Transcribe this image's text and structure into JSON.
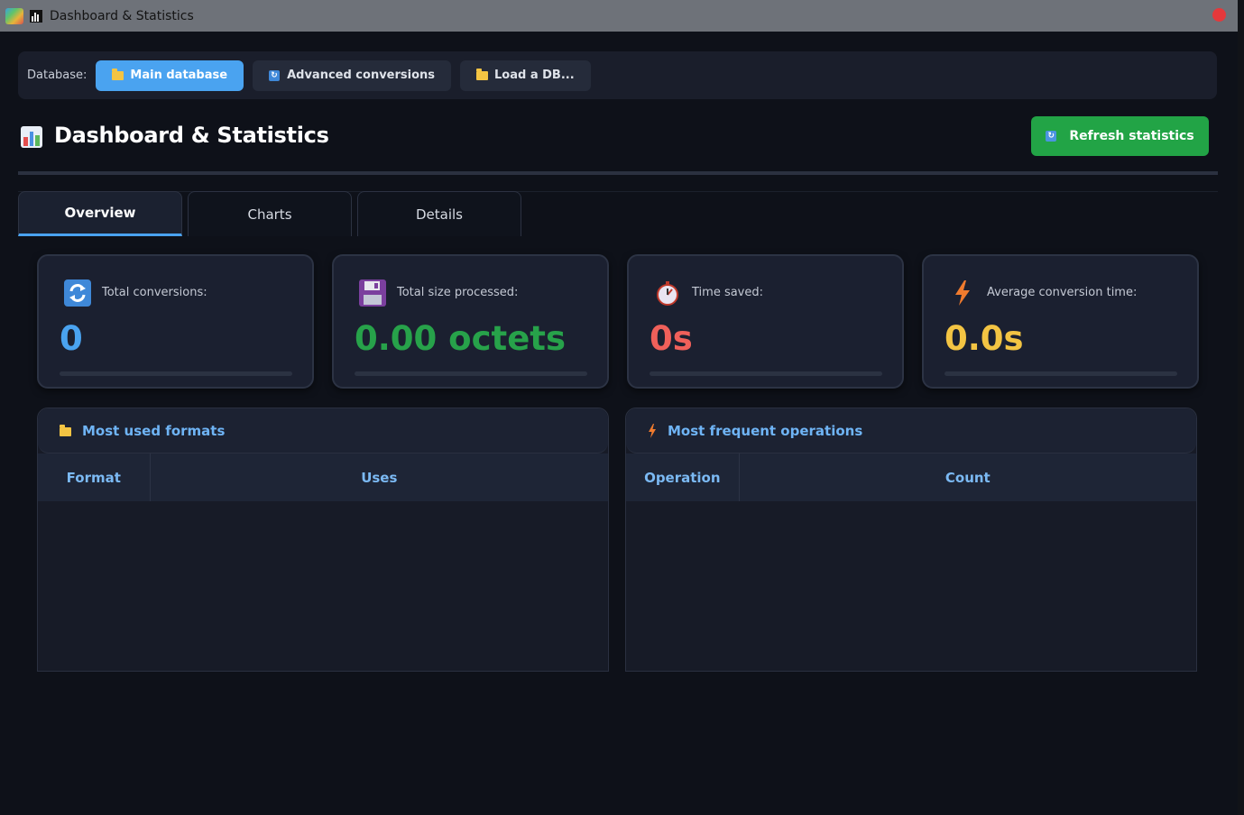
{
  "window": {
    "title": "Dashboard & Statistics"
  },
  "database_bar": {
    "label": "Database:",
    "buttons": [
      {
        "label": "Main database",
        "icon": "folder-icon",
        "active": true
      },
      {
        "label": "Advanced conversions",
        "icon": "refresh-icon",
        "active": false
      },
      {
        "label": "Load a DB...",
        "icon": "folder-open-icon",
        "active": false
      }
    ]
  },
  "header": {
    "title": "Dashboard & Statistics",
    "refresh_label": "Refresh statistics"
  },
  "tabs": [
    {
      "label": "Overview",
      "active": true
    },
    {
      "label": "Charts",
      "active": false
    },
    {
      "label": "Details",
      "active": false
    }
  ],
  "stats": [
    {
      "label": "Total conversions:",
      "value": "0",
      "icon": "refresh-icon",
      "color": "#4aa3f0"
    },
    {
      "label": "Total size processed:",
      "value": "0.00 octets",
      "icon": "floppy-disk-icon",
      "color": "#27a24a"
    },
    {
      "label": "Time saved:",
      "value": "0s",
      "icon": "stopwatch-icon",
      "color": "#f0605a"
    },
    {
      "label": "Average conversion time:",
      "value": "0.0s",
      "icon": "lightning-icon",
      "color": "#f3c443"
    }
  ],
  "formats_panel": {
    "title": "Most used formats",
    "columns": [
      "Format",
      "Uses"
    ],
    "rows": []
  },
  "operations_panel": {
    "title": "Most frequent operations",
    "columns": [
      "Operation",
      "Count"
    ],
    "rows": []
  },
  "colors": {
    "accent": "#4aa3f0",
    "success": "#22a446",
    "background": "#0e1119"
  }
}
